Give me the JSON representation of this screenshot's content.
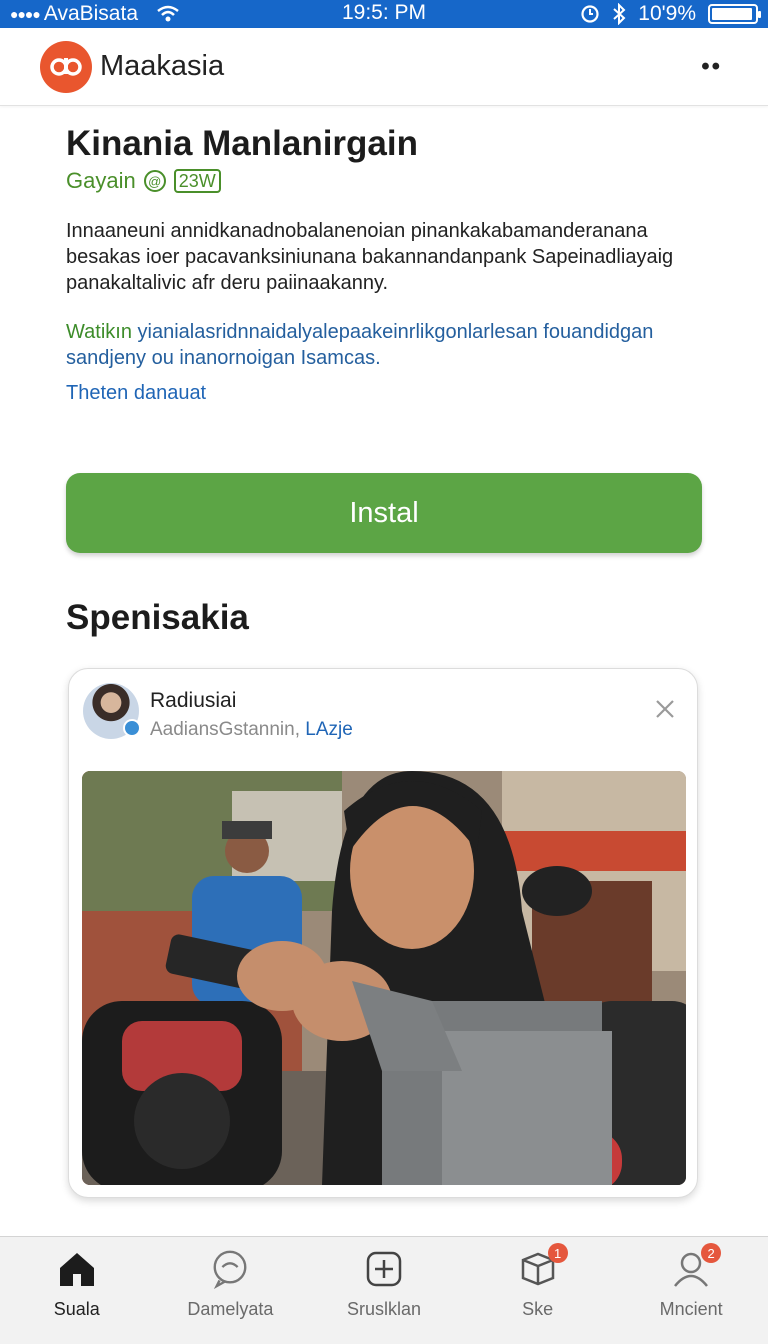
{
  "status_bar": {
    "carrier": "AvaBisata",
    "time": "19:5: PM",
    "battery": "10'9%",
    "battery_level": 0.95
  },
  "app_bar": {
    "app_name": "Maakasia"
  },
  "app_info": {
    "title": "Kinania Manlanirgain",
    "developer": "Gayain",
    "rating_badge": "23W",
    "description": "Innaaneuni annidkanadnobalanenoian pinankakabamanderanana besakas ioer pacavanksiniunana bakannandanpank Sapeinadliayaig panakaltalivic afr deru paiinaakanny.",
    "note_highlight": "Watikın",
    "note_text": "yianialasridnnaidalyalepaakeinrlikgonlarlesan fouandidgan sandjeny ou inanornoigan Isamcas.",
    "more_link": "Theten danauat",
    "install_label": "Instal"
  },
  "section": {
    "title": "Spenisakia"
  },
  "card": {
    "name": "Radiusiai",
    "subtitle": "AadiansGstannin, ",
    "subtitle_accent": "LAzje"
  },
  "tabs": [
    {
      "label": "Suala",
      "icon": "home-icon",
      "active": true
    },
    {
      "label": "Damelyata",
      "icon": "chat-icon"
    },
    {
      "label": "Sruslklan",
      "icon": "add-icon"
    },
    {
      "label": "Ske",
      "icon": "box-icon",
      "badge": "1"
    },
    {
      "label": "Mncient",
      "icon": "profile-icon",
      "badge": "2"
    }
  ],
  "colors": {
    "status_bar": "#1667c9",
    "brand": "#e9562e",
    "install_green": "#5ca545",
    "link_blue": "#1f65b6",
    "badge_red": "#e5573d"
  }
}
